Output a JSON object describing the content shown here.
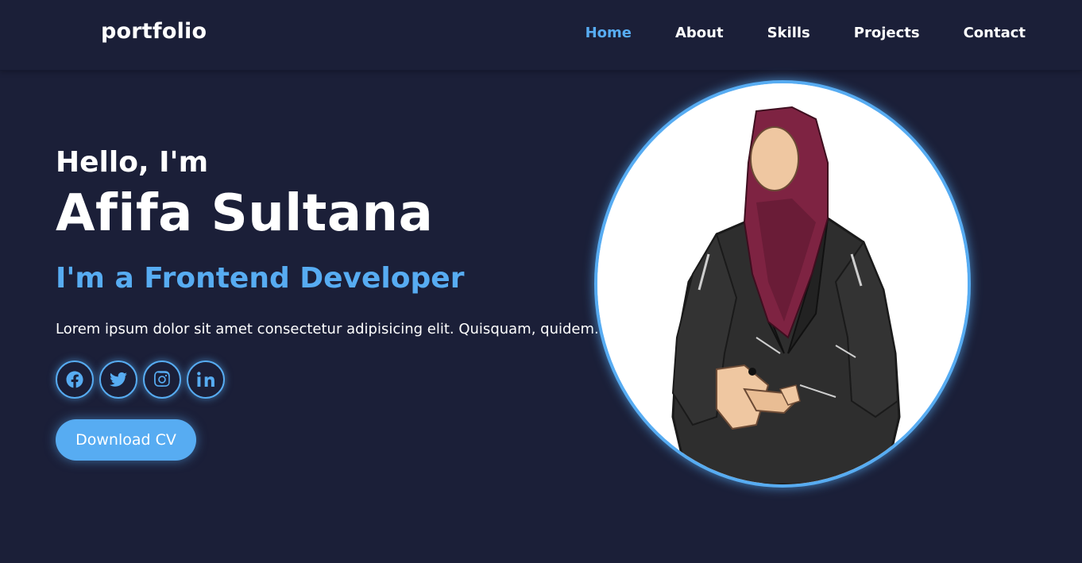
{
  "nav": {
    "logo": "portfolio",
    "links": [
      {
        "label": "Home",
        "active": true
      },
      {
        "label": "About",
        "active": false
      },
      {
        "label": "Skills",
        "active": false
      },
      {
        "label": "Projects",
        "active": false
      },
      {
        "label": "Contact",
        "active": false
      }
    ]
  },
  "hero": {
    "greeting": "Hello, I'm",
    "name": "Afifa Sultana",
    "role": "I'm a Frontend Developer",
    "description": "Lorem ipsum dolor sit amet consectetur adipisicing elit. Quisquam, quidem.",
    "socials": [
      {
        "icon": "facebook-icon"
      },
      {
        "icon": "twitter-icon"
      },
      {
        "icon": "instagram-icon"
      },
      {
        "icon": "linkedin-icon"
      }
    ],
    "cv_button": "Download CV"
  },
  "colors": {
    "background": "#1b1f38",
    "accent": "#57acf2",
    "text": "#ffffff"
  }
}
